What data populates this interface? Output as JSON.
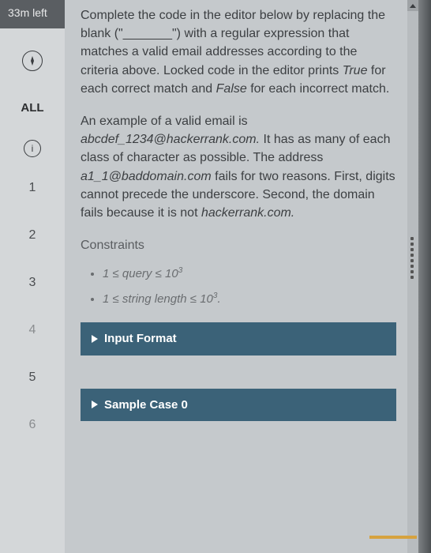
{
  "timer": "33m left",
  "nav": {
    "all_label": "ALL",
    "questions": [
      "1",
      "2",
      "3",
      "4",
      "5",
      "6"
    ]
  },
  "problem": {
    "p1a": "Complete the code in the editor below by replacing the blank (\"",
    "p1blank": "_______",
    "p1b": "\") with a regular expression that matches a valid email addresses according to the criteria above. Locked code in the editor prints ",
    "p1true": "True",
    "p1c": " for each correct match and ",
    "p1false": "False",
    "p1d": " for each incorrect match.",
    "p2a": "An example of a valid email is ",
    "p2ex1": "abcdef_1234@hackerrank.com.",
    "p2b": "  It has as many of each class of character as possible.  The address ",
    "p2ex2": "a1_1@baddomain.com",
    "p2c": " fails for two reasons.  First, digits cannot precede the underscore.  Second, the domain fails because it is not ",
    "p2dom": "hackerrank.com.",
    "constraints_h": "Constraints",
    "c1a": "1 ≤ query ≤ 10",
    "c1sup": "3",
    "c2a": "1 ≤ string length ≤ 10",
    "c2sup": "3",
    "c2end": "."
  },
  "panels": {
    "input_format": "Input Format",
    "sample_case": "Sample Case 0"
  }
}
